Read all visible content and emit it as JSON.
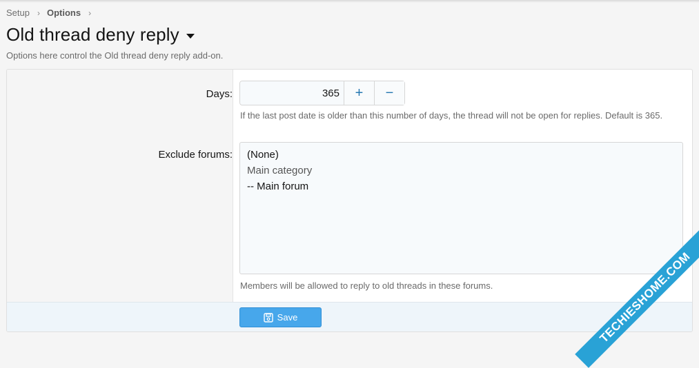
{
  "breadcrumb": {
    "items": [
      "Setup",
      "Options"
    ]
  },
  "header": {
    "title": "Old thread deny reply",
    "description": "Options here control the Old thread deny reply add-on."
  },
  "days": {
    "label": "Days:",
    "value": "365",
    "plus": "+",
    "minus": "−",
    "hint": "If the last post date is older than this number of days, the thread will not be open for replies. Default is 365."
  },
  "exclude": {
    "label": "Exclude forums:",
    "options": [
      "(None)",
      "Main category",
      "-- Main forum"
    ],
    "hint": "Members will be allowed to reply to old threads in these forums."
  },
  "footer": {
    "save_label": "Save"
  },
  "watermark": {
    "text": "TECHIESHOME.COM"
  },
  "colors": {
    "accent": "#47a7eb",
    "link": "#2577b1",
    "ribbon": "#29a2d6"
  }
}
